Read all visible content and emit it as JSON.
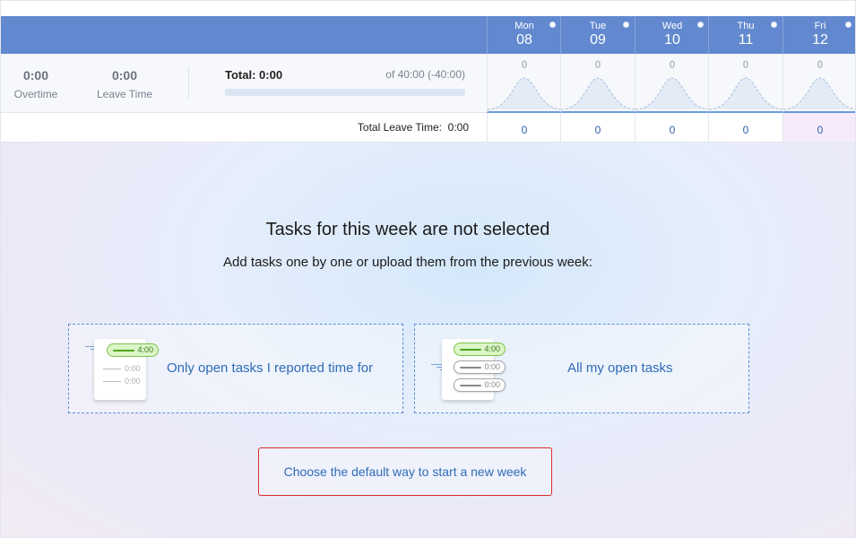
{
  "days": [
    {
      "name": "Mon",
      "num": "08",
      "value": "0",
      "leave": "0"
    },
    {
      "name": "Tue",
      "num": "09",
      "value": "0",
      "leave": "0"
    },
    {
      "name": "Wed",
      "num": "10",
      "value": "0",
      "leave": "0"
    },
    {
      "name": "Thu",
      "num": "11",
      "value": "0",
      "leave": "0"
    },
    {
      "name": "Fri",
      "num": "12",
      "value": "0",
      "leave": "0"
    }
  ],
  "summary": {
    "overtime_value": "0:00",
    "overtime_label": "Overtime",
    "leave_value": "0:00",
    "leave_label": "Leave Time",
    "total_prefix": "Total:",
    "total_value": "0:00",
    "of_text": "of 40:00 (-40:00)",
    "progress": 0
  },
  "leave_row": {
    "label": "Total Leave Time:",
    "value": "0:00"
  },
  "empty_state": {
    "title": "Tasks for this week are not selected",
    "subtitle": "Add tasks one by one or upload them from the previous week:"
  },
  "options": [
    {
      "label": "Only open tasks I reported time for",
      "pill": "4:00",
      "minis": [
        "0:00",
        "0:00"
      ]
    },
    {
      "label": "All my open tasks",
      "pill": "4:00",
      "minis": [
        "0:00",
        "0:00"
      ]
    }
  ],
  "default_button": "Choose the default way to start a new week",
  "colors": {
    "header": "#6289cf",
    "accent_text": "#2f6bb8",
    "highlight_border": "#dc2c2c"
  }
}
